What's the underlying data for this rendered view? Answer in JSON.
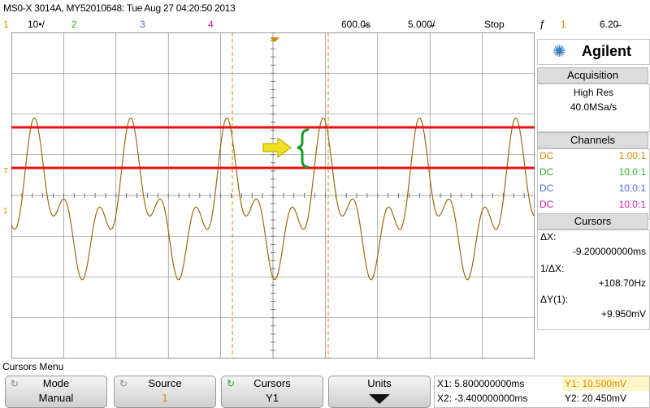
{
  "title": "MS0-X 3014A, MY52010648: Tue Aug 27 04:20:50 2013",
  "channels_row": {
    "ch1_num": "1",
    "ch1_scale": "10•/",
    "ch2_num": "2",
    "ch3_num": "3",
    "ch4_num": "4",
    "time_delay": "600.0̶s",
    "time_div": "5.000̶/",
    "run_state": "Stop",
    "trigger_icon": "ƒ",
    "trigger_ch": "1",
    "trigger_level": "6.20̶"
  },
  "colors": {
    "ch1": "#d68a00",
    "ch2": "#2db02d",
    "ch3": "#4e6ad6",
    "ch4": "#cc22aa",
    "waveform": "#9a6a10",
    "limit_lines": "#e81010",
    "arrow": "#f0e020",
    "brace": "#1a9a2a"
  },
  "panel": {
    "brand": "Agilent",
    "acquisition_header": "Acquisition",
    "acq_mode": "High Res",
    "acq_rate": "40.0MSa/s",
    "channels_header": "Channels",
    "channels": [
      {
        "coupling": "DC",
        "probe": "1.00:1"
      },
      {
        "coupling": "DC",
        "probe": "10.0:1"
      },
      {
        "coupling": "DC",
        "probe": "10.0:1"
      },
      {
        "coupling": "DC",
        "probe": "10.0:1"
      }
    ],
    "cursors_header": "Cursors",
    "dx_label": "ΔX:",
    "dx_value": "-9.200000000ms",
    "inv_dx_label": "1/ΔX:",
    "inv_dx_value": "+108.70Hz",
    "dy_label": "ΔY(1):",
    "dy_value": "+9.950mV"
  },
  "menu": {
    "title": "Cursors Menu",
    "mode_label": "Mode",
    "mode_value": "Manual",
    "source_label": "Source",
    "source_value": "1",
    "cursors_label": "Cursors",
    "cursors_value": "Y1",
    "units_label": "Units",
    "x1": "X1: 5.800000000ms",
    "x2": "X2: -3.400000000ms",
    "y1": "Y1: 10.500mV",
    "y2": "Y2: 20.450mV"
  },
  "markers": {
    "trigger_marker": "T",
    "ground_marker": "1"
  }
}
